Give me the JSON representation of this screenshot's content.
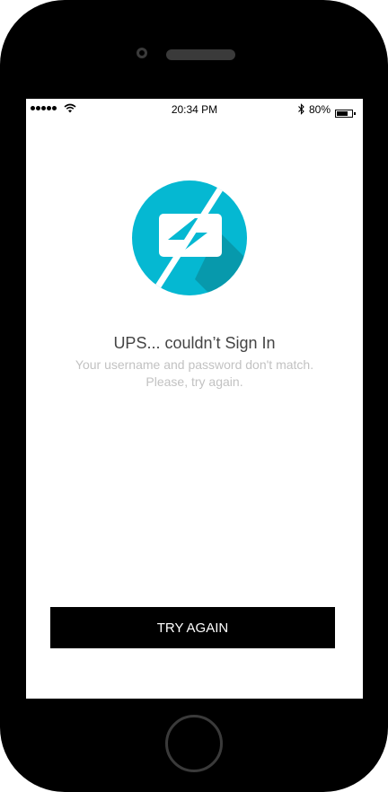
{
  "status_bar": {
    "time": "20:34 PM",
    "battery_percent": "80%",
    "battery_level": 0.8,
    "signal_bars": 5
  },
  "icon": {
    "name": "charging-error-icon",
    "circle_color": "#05b8d2",
    "shadow_color": "#0799ac"
  },
  "error": {
    "title": "UPS... couldn’t Sign In",
    "message_line1": "Your username and password don't match.",
    "message_line2": "Please, try again."
  },
  "actions": {
    "try_again_label": "TRY AGAIN"
  }
}
